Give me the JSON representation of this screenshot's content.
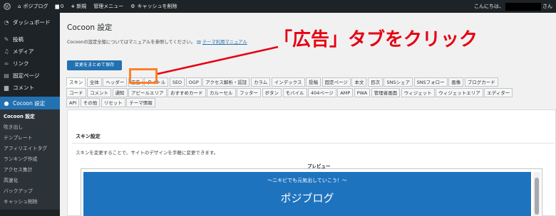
{
  "adminbar": {
    "wp_logo": "wordpress-icon",
    "site_name": "ポジブログ",
    "comments_count": "0",
    "new_label": "新規",
    "admin_menu": "管理メニュー",
    "cache_clear": "キャッシュを削除",
    "greeting": "こんにちは、",
    "greeting_suffix": "さん"
  },
  "sidebar": {
    "top_items": [
      {
        "icon": "dashboard-icon",
        "label": "ダッシュボード"
      }
    ],
    "items": [
      {
        "icon": "pin-icon",
        "label": "投稿"
      },
      {
        "icon": "media-icon",
        "label": "メディア"
      },
      {
        "icon": "link-icon",
        "label": "リンク"
      },
      {
        "icon": "page-icon",
        "label": "固定ページ"
      },
      {
        "icon": "comment-icon",
        "label": "コメント"
      }
    ],
    "current": {
      "icon": "cocoon-icon",
      "label": "Cocoon 設定"
    },
    "submenu": [
      "Cocoon 設定",
      "吹き出し",
      "テンプレート",
      "アフィリエイトタグ",
      "ランキング作成",
      "アクセス集計",
      "高速化",
      "バックアップ",
      "キャッシュ削除"
    ]
  },
  "main": {
    "title": "Cocoon 設定",
    "description": "Cocoonの設定全般についてはマニュアルを参照してください。",
    "manual_link": "テーマ利用マニュアル",
    "save_button": "変更をまとめて保存",
    "tabs_row1": [
      "スキン",
      "全体",
      "ヘッダー",
      "広告",
      "タイトル",
      "SEO",
      "OGP",
      "アクセス解析・認証",
      "カラム",
      "インデックス",
      "投稿",
      "固定ページ",
      "本文",
      "目次",
      "SNSシェア",
      "SNSフォロー",
      "画像",
      "ブログカード"
    ],
    "tabs_row2": [
      "コード",
      "コメント",
      "通知",
      "アピールエリア",
      "おすすめカード",
      "カルーセル",
      "フッター",
      "ボタン",
      "モバイル",
      "404ページ",
      "AMP",
      "PWA",
      "管理者画面",
      "ウィジェット",
      "ウィジェットエリア",
      "エディター"
    ],
    "tabs_row3": [
      "API",
      "その他",
      "リセット",
      "テーマ情報"
    ],
    "active_tab": "スキン"
  },
  "panel": {
    "title": "スキン設定",
    "description": "スキンを変更することで、サイトのデザインを手軽に変更できます。",
    "preview_label": "プレビュー",
    "preview_tagline": "〜ニキビでも元気出していこう！〜",
    "preview_sitename": "ポジブログ"
  },
  "annotation": {
    "text": "「広告」タブをクリック",
    "color": "#e60012",
    "box_color": "#ff7f27"
  },
  "colors": {
    "adminbar_bg": "#1d2327",
    "accent": "#2271b1",
    "preview_header": "#1e73be"
  }
}
